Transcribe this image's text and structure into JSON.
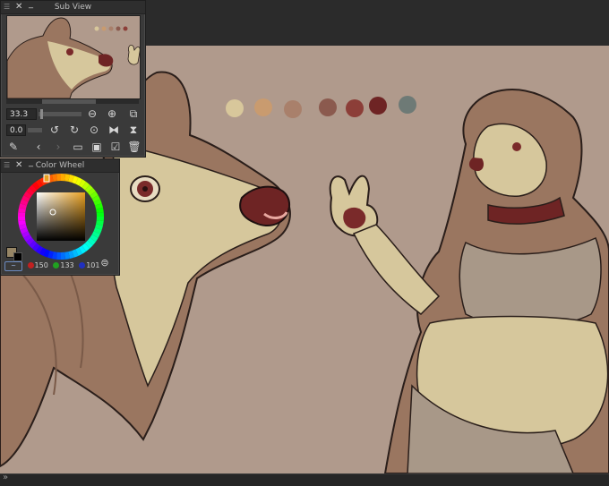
{
  "sub_view": {
    "title": "Sub View",
    "zoom_value": "33.3",
    "rotation_value": "0.0"
  },
  "color_wheel": {
    "title": "Color Wheel",
    "r": "150",
    "g": "133",
    "b": "101",
    "current_color": "#968565"
  },
  "palette_swatches": [
    "#d8c79b",
    "#c99b6f",
    "#a9806b",
    "#8b5a4e",
    "#8c3e38",
    "#6e2424",
    "#6e7a76"
  ],
  "colors": {
    "canvas_bg": "#b09a8c",
    "panel_bg": "#3a3a3a",
    "app_bg": "#2b2b2b",
    "fur_brown": "#9a7660",
    "fur_light": "#d6c79c",
    "nose": "#7a2a2a"
  },
  "icons": {
    "zoom_out": "zoom-out-icon",
    "zoom_in": "zoom-in-icon",
    "fit": "fit-view-icon",
    "rotate_left": "rotate-left-icon",
    "rotate_right": "rotate-right-icon",
    "reset": "reset-rotation-icon",
    "flip_h": "flip-horizontal-icon",
    "flip_v": "flip-vertical-icon",
    "eyedropper": "eyedropper-icon",
    "prev": "previous-image-icon",
    "next": "next-image-icon",
    "open": "open-folder-icon",
    "import": "import-image-icon",
    "edit": "edit-icon",
    "delete": "trash-icon"
  }
}
